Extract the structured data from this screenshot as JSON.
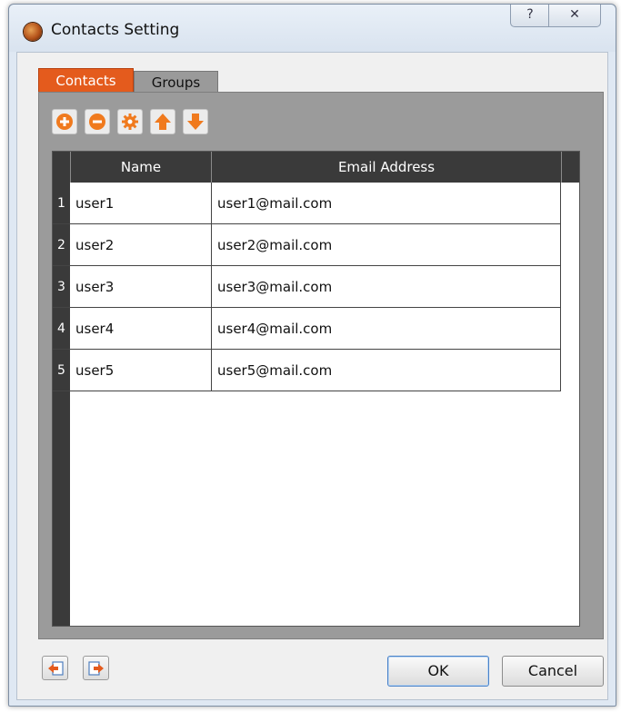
{
  "window": {
    "title": "Contacts Setting",
    "help_glyph": "?",
    "close_glyph": "✕"
  },
  "tabs": [
    {
      "label": "Contacts",
      "active": true
    },
    {
      "label": "Groups",
      "active": false
    }
  ],
  "toolbar": {
    "buttons": [
      "add-icon",
      "remove-icon",
      "settings-icon",
      "move-up-icon",
      "move-down-icon"
    ]
  },
  "table": {
    "columns": [
      "Name",
      "Email Address"
    ],
    "rows": [
      {
        "num": "1",
        "name": "user1",
        "email": "user1@mail.com"
      },
      {
        "num": "2",
        "name": "user2",
        "email": "user2@mail.com"
      },
      {
        "num": "3",
        "name": "user3",
        "email": "user3@mail.com"
      },
      {
        "num": "4",
        "name": "user4",
        "email": "user4@mail.com"
      },
      {
        "num": "5",
        "name": "user5",
        "email": "user5@mail.com"
      }
    ]
  },
  "footer": {
    "import_icon": "import-icon",
    "export_icon": "export-icon",
    "ok_label": "OK",
    "cancel_label": "Cancel"
  },
  "colors": {
    "accent": "#e45b1d",
    "toolbar_icon": "#f07a1e",
    "header_bg": "#3a3a3a"
  }
}
